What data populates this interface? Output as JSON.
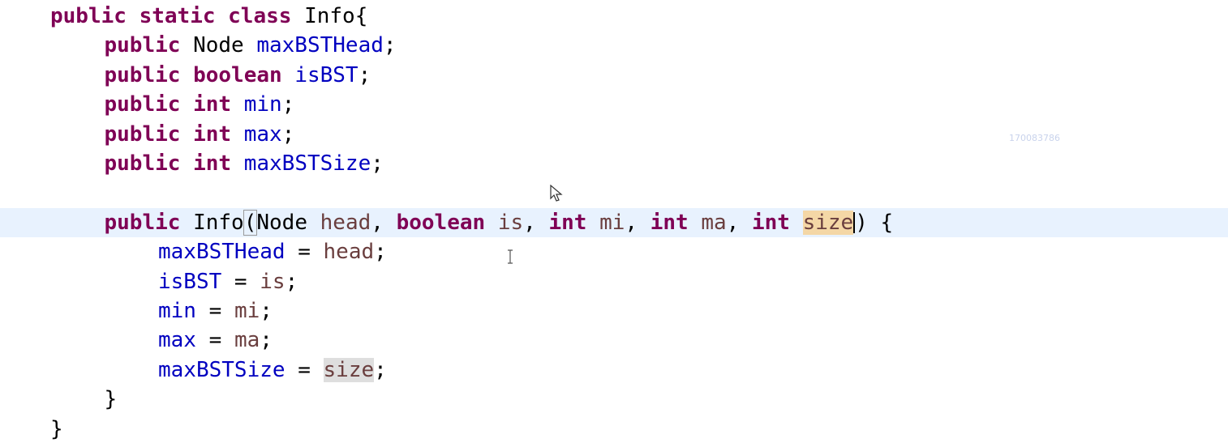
{
  "editor": {
    "lines": [
      {
        "indent": 0,
        "current": false,
        "tokens": [
          {
            "t": "public",
            "c": "kw"
          },
          {
            "t": " ",
            "c": "plain"
          },
          {
            "t": "static",
            "c": "kw"
          },
          {
            "t": " ",
            "c": "plain"
          },
          {
            "t": "class",
            "c": "kw"
          },
          {
            "t": " Info{",
            "c": "plain"
          }
        ]
      },
      {
        "indent": 1,
        "current": false,
        "tokens": [
          {
            "t": "public",
            "c": "kw"
          },
          {
            "t": " Node ",
            "c": "plain"
          },
          {
            "t": "maxBSTHead",
            "c": "field"
          },
          {
            "t": ";",
            "c": "plain"
          }
        ]
      },
      {
        "indent": 1,
        "current": false,
        "tokens": [
          {
            "t": "public",
            "c": "kw"
          },
          {
            "t": " ",
            "c": "plain"
          },
          {
            "t": "boolean",
            "c": "kw"
          },
          {
            "t": " ",
            "c": "plain"
          },
          {
            "t": "isBST",
            "c": "field"
          },
          {
            "t": ";",
            "c": "plain"
          }
        ]
      },
      {
        "indent": 1,
        "current": false,
        "tokens": [
          {
            "t": "public",
            "c": "kw"
          },
          {
            "t": " ",
            "c": "plain"
          },
          {
            "t": "int",
            "c": "kw"
          },
          {
            "t": " ",
            "c": "plain"
          },
          {
            "t": "min",
            "c": "field"
          },
          {
            "t": ";",
            "c": "plain"
          }
        ]
      },
      {
        "indent": 1,
        "current": false,
        "tokens": [
          {
            "t": "public",
            "c": "kw"
          },
          {
            "t": " ",
            "c": "plain"
          },
          {
            "t": "int",
            "c": "kw"
          },
          {
            "t": " ",
            "c": "plain"
          },
          {
            "t": "max",
            "c": "field"
          },
          {
            "t": ";",
            "c": "plain"
          }
        ]
      },
      {
        "indent": 1,
        "current": false,
        "tokens": [
          {
            "t": "public",
            "c": "kw"
          },
          {
            "t": " ",
            "c": "plain"
          },
          {
            "t": "int",
            "c": "kw"
          },
          {
            "t": " ",
            "c": "plain"
          },
          {
            "t": "maxBSTSize",
            "c": "field"
          },
          {
            "t": ";",
            "c": "plain"
          }
        ]
      },
      {
        "indent": 0,
        "current": false,
        "tokens": []
      },
      {
        "indent": 1,
        "current": true,
        "tokens": [
          {
            "t": "public",
            "c": "kw"
          },
          {
            "t": " Info",
            "c": "plain"
          },
          {
            "t": "(",
            "c": "plain bracket-box"
          },
          {
            "t": "Node ",
            "c": "plain"
          },
          {
            "t": "head",
            "c": "param"
          },
          {
            "t": ", ",
            "c": "plain"
          },
          {
            "t": "boolean",
            "c": "kw"
          },
          {
            "t": " ",
            "c": "plain"
          },
          {
            "t": "is",
            "c": "param"
          },
          {
            "t": ", ",
            "c": "plain"
          },
          {
            "t": "int",
            "c": "kw"
          },
          {
            "t": " ",
            "c": "plain"
          },
          {
            "t": "mi",
            "c": "param"
          },
          {
            "t": ", ",
            "c": "plain"
          },
          {
            "t": "int",
            "c": "kw"
          },
          {
            "t": " ",
            "c": "plain"
          },
          {
            "t": "ma",
            "c": "param"
          },
          {
            "t": ", ",
            "c": "plain"
          },
          {
            "t": "int",
            "c": "kw"
          },
          {
            "t": " ",
            "c": "plain"
          },
          {
            "t": "size",
            "c": "param occ-write"
          },
          {
            "t": "|caret|",
            "c": "caret"
          },
          {
            "t": ") {",
            "c": "plain"
          }
        ]
      },
      {
        "indent": 2,
        "current": false,
        "tokens": [
          {
            "t": "maxBSTHead",
            "c": "field"
          },
          {
            "t": " = ",
            "c": "plain"
          },
          {
            "t": "head",
            "c": "param"
          },
          {
            "t": ";",
            "c": "plain"
          }
        ]
      },
      {
        "indent": 2,
        "current": false,
        "tokens": [
          {
            "t": "isBST",
            "c": "field"
          },
          {
            "t": " = ",
            "c": "plain"
          },
          {
            "t": "is",
            "c": "param"
          },
          {
            "t": ";",
            "c": "plain"
          }
        ]
      },
      {
        "indent": 2,
        "current": false,
        "tokens": [
          {
            "t": "min",
            "c": "field"
          },
          {
            "t": " = ",
            "c": "plain"
          },
          {
            "t": "mi",
            "c": "param"
          },
          {
            "t": ";",
            "c": "plain"
          }
        ]
      },
      {
        "indent": 2,
        "current": false,
        "tokens": [
          {
            "t": "max",
            "c": "field"
          },
          {
            "t": " = ",
            "c": "plain"
          },
          {
            "t": "ma",
            "c": "param"
          },
          {
            "t": ";",
            "c": "plain"
          }
        ]
      },
      {
        "indent": 2,
        "current": false,
        "tokens": [
          {
            "t": "maxBSTSize",
            "c": "field"
          },
          {
            "t": " = ",
            "c": "plain"
          },
          {
            "t": "size",
            "c": "param occ-read"
          },
          {
            "t": ";",
            "c": "plain"
          }
        ]
      },
      {
        "indent": 1,
        "current": false,
        "tokens": [
          {
            "t": "}",
            "c": "plain"
          }
        ]
      },
      {
        "indent": 0,
        "current": false,
        "tokens": [
          {
            "t": "}",
            "c": "plain"
          }
        ]
      }
    ]
  },
  "watermark": {
    "text": "170083786"
  },
  "cursors": {
    "pointer": "arrow-pointer-icon",
    "text": "i-beam-cursor-icon"
  },
  "colors": {
    "keyword": "#7f0055",
    "field": "#0000c0",
    "parameter": "#6a3e3e",
    "current_line": "#e8f2fe",
    "write_occurrence": "#f4d7a6",
    "read_occurrence": "#dedede"
  }
}
